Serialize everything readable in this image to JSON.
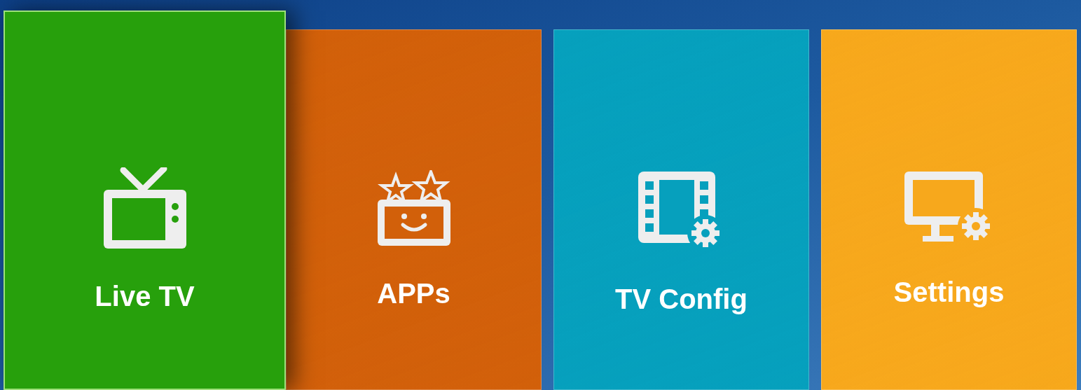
{
  "tiles": [
    {
      "label": "Live TV",
      "kind": "tv",
      "color": "#27a00c",
      "selected": true
    },
    {
      "label": "APPs",
      "kind": "apps",
      "color": "#d2600a",
      "selected": false
    },
    {
      "label": "TV Config",
      "kind": "config",
      "color": "#06a0bd",
      "selected": false
    },
    {
      "label": "Settings",
      "kind": "settings",
      "color": "#f7a81c",
      "selected": false
    }
  ]
}
